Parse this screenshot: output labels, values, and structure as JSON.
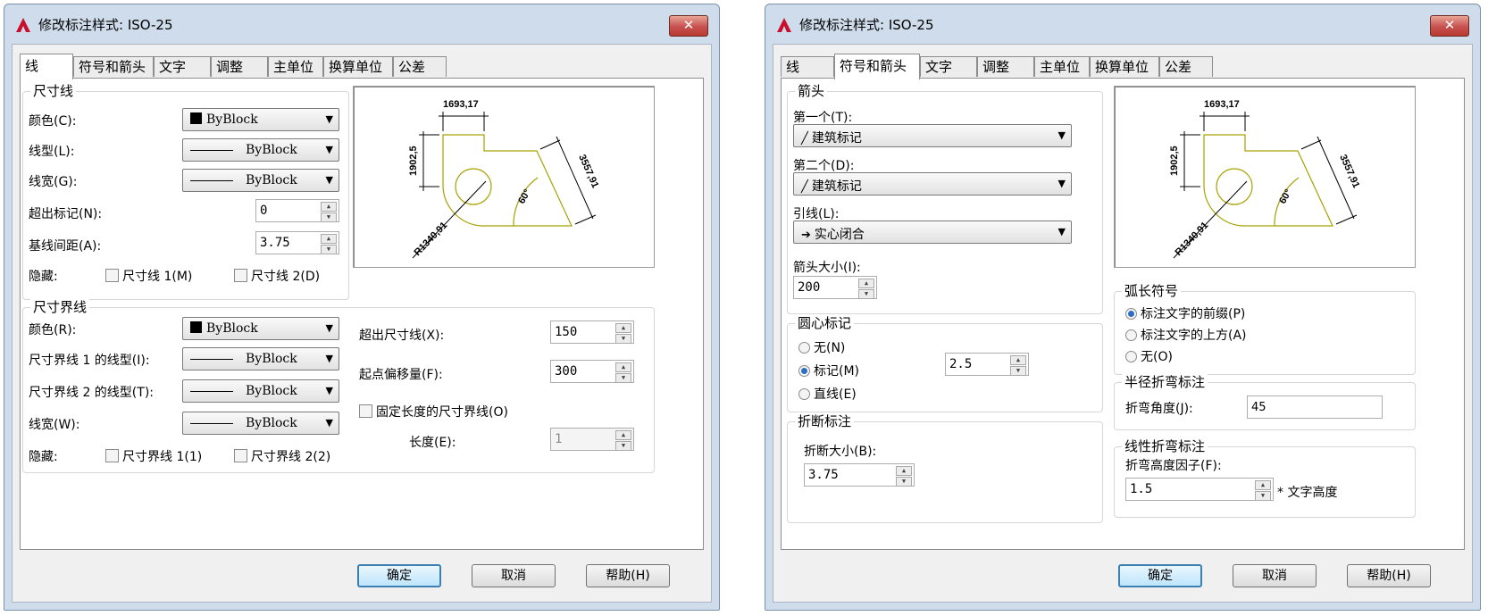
{
  "window_title": "修改标注样式: ISO-25",
  "close_label": "✕",
  "tabs": [
    "线",
    "符号和箭头",
    "文字",
    "调整",
    "主单位",
    "换算单位",
    "公差"
  ],
  "buttons": {
    "ok": "确定",
    "cancel": "取消",
    "help": "帮助(H)"
  },
  "preview": {
    "dim_top": "1693,17",
    "dim_left": "1902,5",
    "dim_right": "3557,91",
    "angle": "60°",
    "radius": "R1340,91"
  },
  "lines_tab": {
    "dim_group": "尺寸线",
    "color_label": "颜色(C):",
    "color_value": "ByBlock",
    "linetype_label": "线型(L):",
    "linetype_value": "ByBlock",
    "lineweight_label": "线宽(G):",
    "lineweight_value": "ByBlock",
    "extend_label": "超出标记(N):",
    "extend_value": "0",
    "baseline_label": "基线间距(A):",
    "baseline_value": "3.75",
    "hide_label": "隐藏:",
    "hide1": "尺寸线 1(M)",
    "hide2": "尺寸线 2(D)",
    "ext_group": "尺寸界线",
    "ext_color_label": "颜色(R):",
    "ext_color_value": "ByBlock",
    "ext1_type_label": "尺寸界线 1 的线型(I):",
    "ext1_type_value": "ByBlock",
    "ext2_type_label": "尺寸界线 2 的线型(T):",
    "ext2_type_value": "ByBlock",
    "ext_weight_label": "线宽(W):",
    "ext_weight_value": "ByBlock",
    "ext_hide_label": "隐藏:",
    "ext_hide1": "尺寸界线 1(1)",
    "ext_hide2": "尺寸界线 2(2)",
    "beyond_label": "超出尺寸线(X):",
    "beyond_value": "150",
    "offset_label": "起点偏移量(F):",
    "offset_value": "300",
    "fixed_label": "固定长度的尺寸界线(O)",
    "length_label": "长度(E):",
    "length_value": "1"
  },
  "symbols_tab": {
    "arrow_group": "箭头",
    "first_label": "第一个(T):",
    "first_value": "建筑标记",
    "second_label": "第二个(D):",
    "second_value": "建筑标记",
    "leader_label": "引线(L):",
    "leader_value": "实心闭合",
    "size_label": "箭头大小(I):",
    "size_value": "200",
    "center_group": "圆心标记",
    "center_none": "无(N)",
    "center_mark": "标记(M)",
    "center_line": "直线(E)",
    "center_value": "2.5",
    "break_group": "折断标注",
    "break_label": "折断大小(B):",
    "break_value": "3.75",
    "arc_group": "弧长符号",
    "arc_prefix": "标注文字的前缀(P)",
    "arc_above": "标注文字的上方(A)",
    "arc_none": "无(O)",
    "jog_group": "半径折弯标注",
    "jog_angle_label": "折弯角度(J):",
    "jog_angle_value": "45",
    "linear_jog_group": "线性折弯标注",
    "jog_height_label": "折弯高度因子(F):",
    "jog_height_value": "1.5",
    "jog_height_suffix": "* 文字高度"
  },
  "colors": {
    "drawing": "#a8a000",
    "accent": "#2b6fc4"
  }
}
